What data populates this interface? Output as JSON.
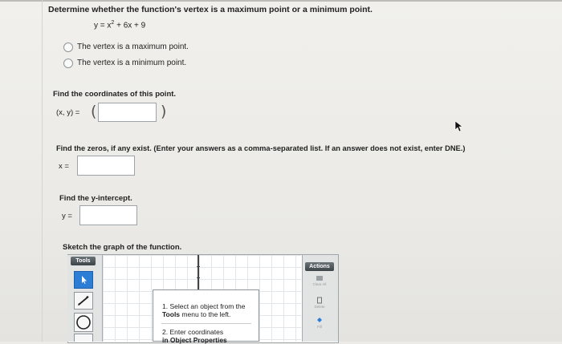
{
  "question": {
    "prompt": "Determine whether the function's vertex is a maximum point or a minimum point.",
    "function_lhs": "y = x",
    "function_exp": "2",
    "function_rhs": " + 6x + 9",
    "options": [
      {
        "label": "The vertex is a maximum point.",
        "selected": false
      },
      {
        "label": "The vertex is a minimum point.",
        "selected": false
      }
    ]
  },
  "coordinates": {
    "prompt": "Find the coordinates of this point.",
    "label": "(x, y) =",
    "open_paren": "(",
    "close_paren": ")",
    "value": ""
  },
  "zeros": {
    "prompt": "Find the zeros, if any exist. (Enter your answers as a comma-separated list. If an answer does not exist, enter DNE.)",
    "label": "x =",
    "value": ""
  },
  "intercept": {
    "prompt": "Find the y-intercept.",
    "label": "y =",
    "value": ""
  },
  "sketch": {
    "prompt": "Sketch the graph of the function.",
    "tools_header": "Tools",
    "actions_header": "Actions",
    "tools": [
      "pointer-icon",
      "line-icon",
      "circle-icon"
    ],
    "actions": [
      "Clear All",
      "Delete",
      "Fill"
    ],
    "instruction_1_line1": "1. Select an object from the",
    "instruction_1_bold": "Tools",
    "instruction_1_rest": " menu to the left.",
    "instruction_2_line1": "2. Enter coordinates",
    "instruction_2_line2": "in Object Properties",
    "accent_color": "#2c7dd6"
  }
}
